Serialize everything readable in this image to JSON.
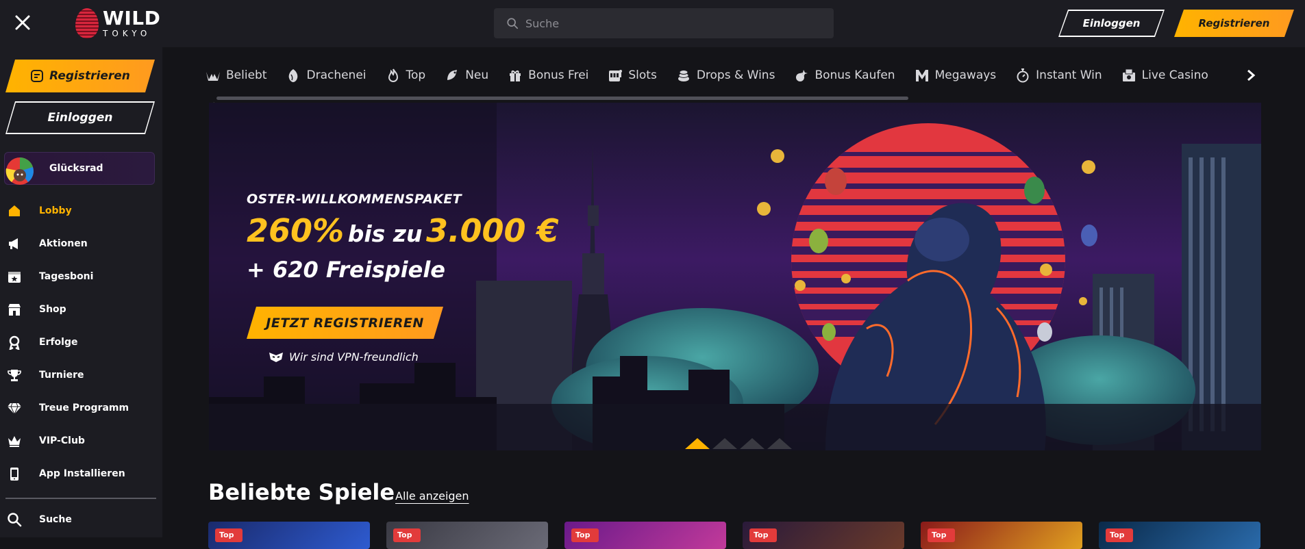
{
  "header": {
    "logo_wild": "WILD",
    "logo_tokyo": "TOKYO",
    "search_placeholder": "Suche",
    "login_label": "Einloggen",
    "register_label": "Registrieren"
  },
  "sidebar": {
    "register_label": "Registrieren",
    "login_label": "Einloggen",
    "wheel_label": "Glücksrad",
    "items": [
      {
        "label": "Lobby",
        "icon": "home-icon",
        "active": true
      },
      {
        "label": "Aktionen",
        "icon": "megaphone-icon"
      },
      {
        "label": "Tagesboni",
        "icon": "calendar-star-icon"
      },
      {
        "label": "Shop",
        "icon": "shop-icon"
      },
      {
        "label": "Erfolge",
        "icon": "medal-icon"
      },
      {
        "label": "Turniere",
        "icon": "trophy-icon"
      },
      {
        "label": "Treue Programm",
        "icon": "diamond-icon"
      },
      {
        "label": "VIP-Club",
        "icon": "crown-icon"
      },
      {
        "label": "App Installieren",
        "icon": "phone-icon"
      }
    ],
    "search_label": "Suche"
  },
  "categories": [
    {
      "label": "Beliebt",
      "icon": "crown-w-icon"
    },
    {
      "label": "Drachenei",
      "icon": "dragon-egg-icon"
    },
    {
      "label": "Top",
      "icon": "flame-icon"
    },
    {
      "label": "Neu",
      "icon": "new-icon"
    },
    {
      "label": "Bonus Frei",
      "icon": "gift-icon"
    },
    {
      "label": "Slots",
      "icon": "slot-machine-icon"
    },
    {
      "label": "Drops & Wins",
      "icon": "drops-icon"
    },
    {
      "label": "Bonus Kaufen",
      "icon": "bonus-buy-icon"
    },
    {
      "label": "Megaways",
      "icon": "megaways-icon"
    },
    {
      "label": "Instant Win",
      "icon": "stopwatch-icon"
    },
    {
      "label": "Live Casino",
      "icon": "live-casino-icon"
    }
  ],
  "banner": {
    "subtitle": "OSTER-WILLKOMMENSPAKET",
    "percent": "260%",
    "bis_zu": "bis zu",
    "amount": "3.000 €",
    "freispiele": "+ 620 Freispiele",
    "cta_label": "JETZT REGISTRIEREN",
    "vpn_label": "Wir sind VPN-freundlich"
  },
  "games_section": {
    "title": "Beliebte Spiele",
    "show_all": "Alle anzeigen",
    "tiles": [
      {
        "badge": "Top"
      },
      {
        "badge": "Top"
      },
      {
        "badge": "Top"
      },
      {
        "badge": "Top"
      },
      {
        "badge": "Top"
      },
      {
        "badge": "Top"
      }
    ]
  },
  "colors": {
    "accent": "#ffb300",
    "background": "#141418",
    "sidebar": "#1c1c22"
  }
}
